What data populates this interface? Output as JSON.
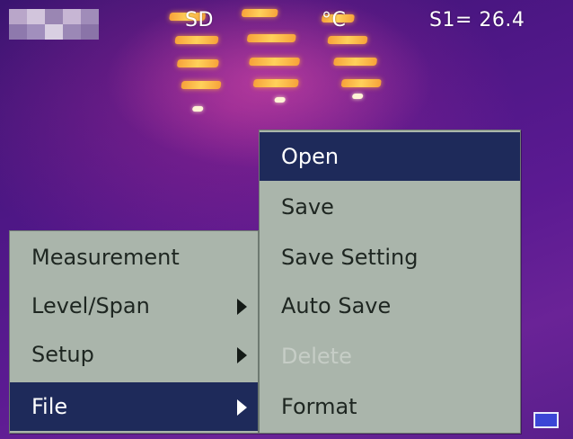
{
  "status": {
    "storage": "SD",
    "unit": "°C",
    "spot_readout": "S1= 26.4"
  },
  "main_menu": {
    "items": [
      {
        "label": "Measurement",
        "has_submenu": false,
        "selected": false
      },
      {
        "label": "Level/Span",
        "has_submenu": true,
        "selected": false
      },
      {
        "label": "Setup",
        "has_submenu": true,
        "selected": false
      },
      {
        "label": "File",
        "has_submenu": true,
        "selected": true
      }
    ]
  },
  "file_menu": {
    "items": [
      {
        "label": "Open",
        "selected": true,
        "enabled": true
      },
      {
        "label": "Save",
        "selected": false,
        "enabled": true
      },
      {
        "label": "Save Setting",
        "selected": false,
        "enabled": true
      },
      {
        "label": "Auto Save",
        "selected": false,
        "enabled": true
      },
      {
        "label": "Delete",
        "selected": false,
        "enabled": false
      },
      {
        "label": "Format",
        "selected": false,
        "enabled": true
      }
    ]
  },
  "colors": {
    "menu_bg": "#aab5ab",
    "selected_bg": "#1e2a5a",
    "battery": "#3b46d6"
  },
  "icons": {
    "battery": "battery-icon",
    "submenu_arrow": "chevron-right-icon"
  }
}
